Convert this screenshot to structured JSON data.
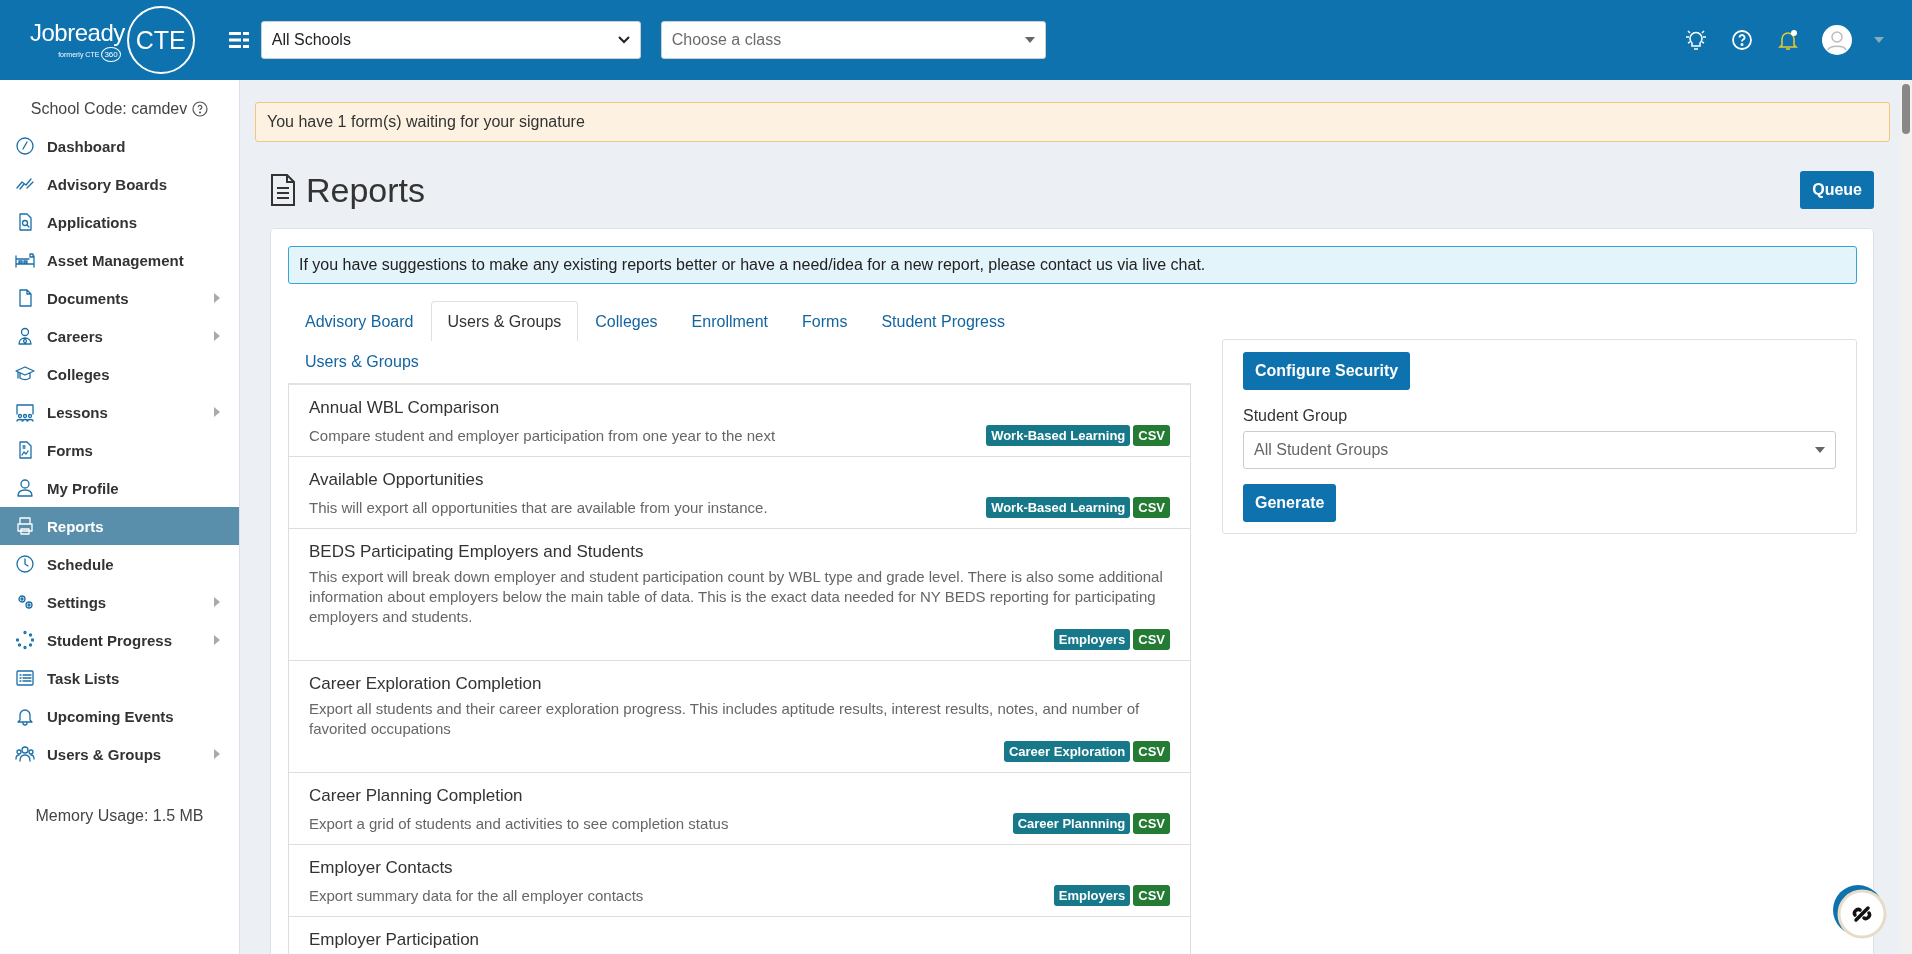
{
  "header": {
    "logo": {
      "name": "Jobready",
      "circle": "CTE",
      "formerly": "formerly CTE",
      "formerly_badge": "360"
    },
    "school_select": {
      "value": "All Schools"
    },
    "class_select": {
      "placeholder": "Choose a class"
    },
    "notifications_unread": true
  },
  "sidebar": {
    "school_code": "School Code: camdev",
    "items": [
      {
        "label": "Dashboard",
        "has_submenu": false,
        "selected": false
      },
      {
        "label": "Advisory Boards",
        "has_submenu": false,
        "selected": false
      },
      {
        "label": "Applications",
        "has_submenu": false,
        "selected": false
      },
      {
        "label": "Asset Management",
        "has_submenu": false,
        "selected": false
      },
      {
        "label": "Documents",
        "has_submenu": true,
        "selected": false
      },
      {
        "label": "Careers",
        "has_submenu": true,
        "selected": false
      },
      {
        "label": "Colleges",
        "has_submenu": false,
        "selected": false
      },
      {
        "label": "Lessons",
        "has_submenu": true,
        "selected": false
      },
      {
        "label": "Forms",
        "has_submenu": false,
        "selected": false
      },
      {
        "label": "My Profile",
        "has_submenu": false,
        "selected": false
      },
      {
        "label": "Reports",
        "has_submenu": false,
        "selected": true
      },
      {
        "label": "Schedule",
        "has_submenu": false,
        "selected": false
      },
      {
        "label": "Settings",
        "has_submenu": true,
        "selected": false
      },
      {
        "label": "Student Progress",
        "has_submenu": true,
        "selected": false
      },
      {
        "label": "Task Lists",
        "has_submenu": false,
        "selected": false
      },
      {
        "label": "Upcoming Events",
        "has_submenu": false,
        "selected": false
      },
      {
        "label": "Users & Groups",
        "has_submenu": true,
        "selected": false
      }
    ],
    "memory_usage": "Memory Usage: 1.5 MB"
  },
  "alert": "You have 1 form(s) waiting for your signature",
  "page_title": "Reports",
  "queue_button": "Queue",
  "info": "If you have suggestions to make any existing reports better or have a need/idea for a new report, please contact us via live chat.",
  "tab_rows": [
    [
      {
        "label": "Advisory Board",
        "selected": false
      },
      {
        "label": "Users & Groups",
        "selected": true
      },
      {
        "label": "Colleges",
        "selected": false
      },
      {
        "label": "Enrollment",
        "selected": false
      },
      {
        "label": "Forms",
        "selected": false
      },
      {
        "label": "Student Progress",
        "selected": false
      }
    ],
    [
      {
        "label": "Users & Groups",
        "selected": false
      }
    ]
  ],
  "reports": [
    {
      "title": "Annual WBL Comparison",
      "description": "Compare student and employer participation from one year to the next",
      "badges": [
        {
          "kind": "category",
          "text": "Work-Based Learning"
        },
        {
          "kind": "format",
          "text": "CSV"
        }
      ]
    },
    {
      "title": "Available Opportunities",
      "description": "This will export all opportunities that are available from your instance.",
      "badges": [
        {
          "kind": "category",
          "text": "Work-Based Learning"
        },
        {
          "kind": "format",
          "text": "CSV"
        }
      ]
    },
    {
      "title": "BEDS Participating Employers and Students",
      "description": "This export will break down employer and student participation count by WBL type and grade level. There is also some additional information about employers below the main table of data. This is the exact data needed for NY BEDS reporting for participating employers and students.",
      "badges": [
        {
          "kind": "category",
          "text": "Employers"
        },
        {
          "kind": "format",
          "text": "CSV"
        }
      ]
    },
    {
      "title": "Career Exploration Completion",
      "description": "Export all students and their career exploration progress. This includes aptitude results, interest results, notes, and number of favorited occupations",
      "badges": [
        {
          "kind": "category",
          "text": "Career Exploration"
        },
        {
          "kind": "format",
          "text": "CSV"
        }
      ]
    },
    {
      "title": "Career Planning Completion",
      "description": "Export a grid of students and activities to see completion status",
      "badges": [
        {
          "kind": "category",
          "text": "Career Plannning"
        },
        {
          "kind": "format",
          "text": "CSV"
        }
      ]
    },
    {
      "title": "Employer Contacts",
      "description": "Export summary data for the all employer contacts",
      "badges": [
        {
          "kind": "category",
          "text": "Employers"
        },
        {
          "kind": "format",
          "text": "CSV"
        }
      ]
    },
    {
      "title": "Employer Participation"
    }
  ],
  "options_panel": {
    "configure_button": "Configure Security",
    "group_label": "Student Group",
    "group_select": {
      "value": "All Student Groups"
    },
    "generate_button": "Generate"
  }
}
